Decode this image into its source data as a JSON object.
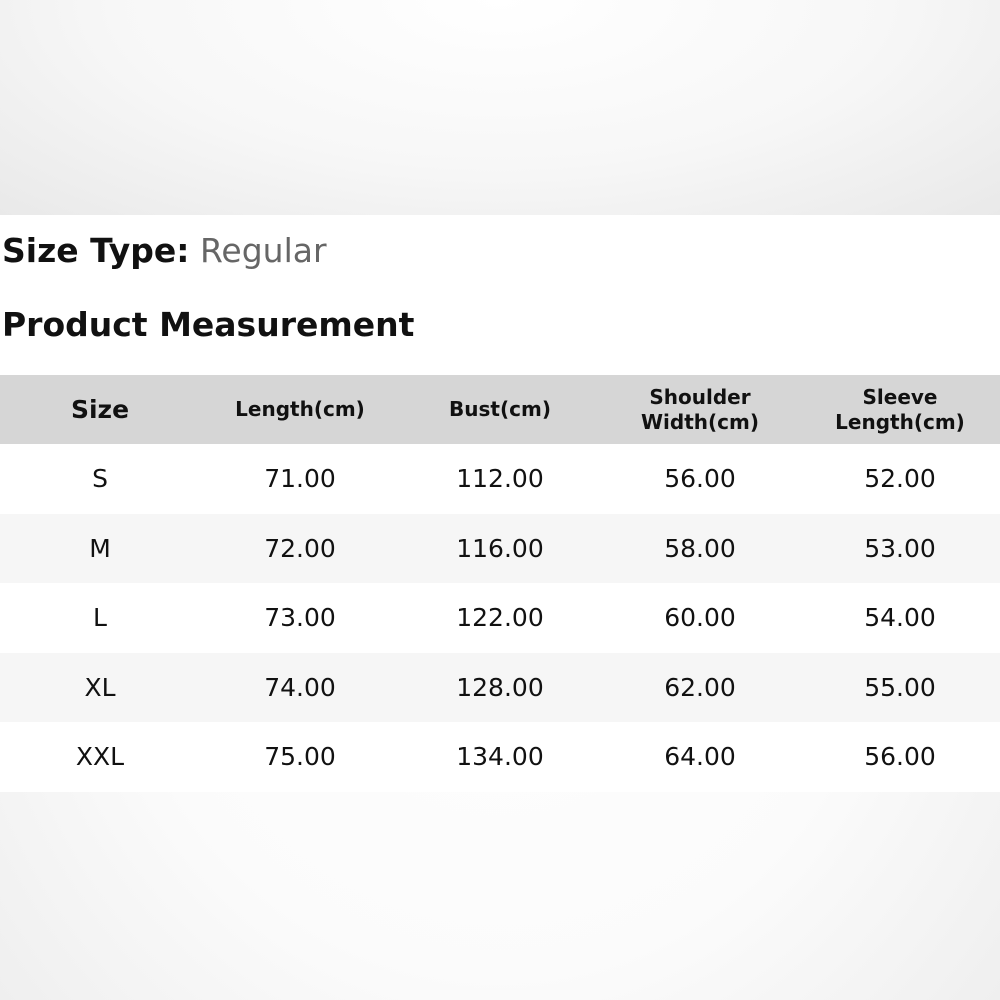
{
  "size_type": {
    "label": "Size Type:",
    "value": "Regular"
  },
  "section_title": "Product Measurement",
  "table": {
    "headers": [
      [
        "Size"
      ],
      [
        "Length(cm)"
      ],
      [
        "Bust(cm)"
      ],
      [
        "Shoulder",
        "Width(cm)"
      ],
      [
        "Sleeve",
        "Length(cm)"
      ]
    ],
    "rows": [
      [
        "S",
        "71.00",
        "112.00",
        "56.00",
        "52.00"
      ],
      [
        "M",
        "72.00",
        "116.00",
        "58.00",
        "53.00"
      ],
      [
        "L",
        "73.00",
        "122.00",
        "60.00",
        "54.00"
      ],
      [
        "XL",
        "74.00",
        "128.00",
        "62.00",
        "55.00"
      ],
      [
        "XXL",
        "75.00",
        "134.00",
        "64.00",
        "56.00"
      ]
    ]
  },
  "colors": {
    "header_bg": "#d6d6d6",
    "alt_row_bg": "#f6f6f6",
    "value_gray": "#666666"
  }
}
